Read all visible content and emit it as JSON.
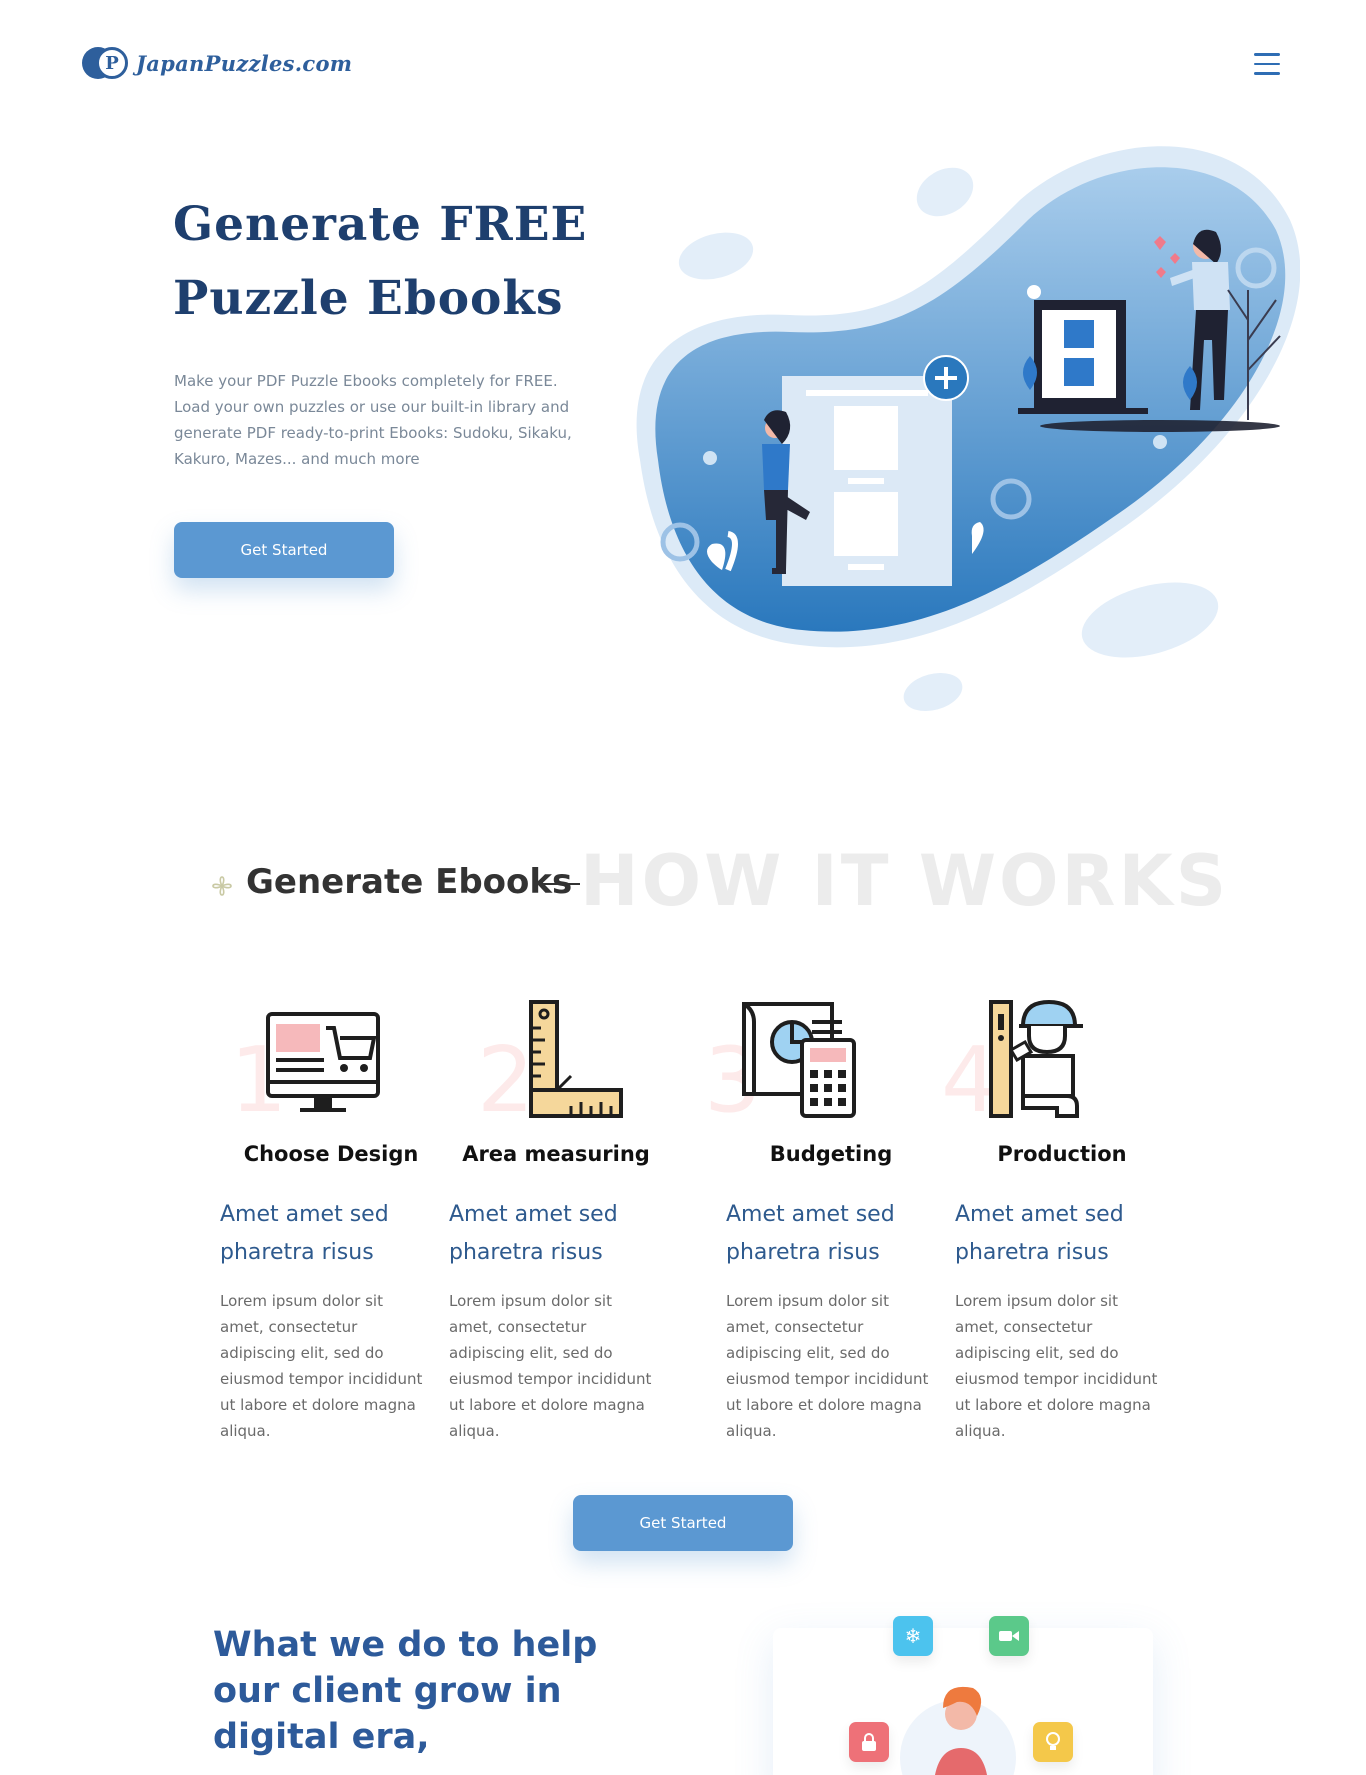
{
  "brand": {
    "logo_letter": "P",
    "name": "JapanPuzzles.com"
  },
  "hero": {
    "title": "Generate FREE Puzzle Ebooks",
    "description": "Make your PDF Puzzle Ebooks completely for FREE. Load your own puzzles or use our built-in library and generate PDF ready-to-print Ebooks: Sudoku, Sikaku, Kakuro, Mazes... and much more",
    "button": "Get Started"
  },
  "how": {
    "background_word": "HOW IT WORKS",
    "title": "Generate Ebooks",
    "steps": [
      {
        "num": "1",
        "label": "Choose Design",
        "subtitle": "Amet amet sed pharetra risus",
        "body": "Lorem ipsum dolor sit amet, consectetur adipiscing elit, sed do eiusmod tempor incididunt ut labore et dolore magna aliqua.",
        "icon": "monitor-cart-icon"
      },
      {
        "num": "2",
        "label": "Area measuring",
        "subtitle": "Amet amet sed pharetra risus",
        "body": "Lorem ipsum dolor sit amet, consectetur adipiscing elit, sed do eiusmod tempor incididunt ut labore et dolore magna aliqua.",
        "icon": "ruler-square-icon"
      },
      {
        "num": "3",
        "label": "Budgeting",
        "subtitle": "Amet amet sed pharetra risus",
        "body": "Lorem ipsum dolor sit amet, consectetur adipiscing elit, sed do eiusmod tempor incididunt ut labore et dolore magna aliqua.",
        "icon": "calculator-blueprint-icon"
      },
      {
        "num": "4",
        "label": "Production",
        "subtitle": "Amet amet sed pharetra risus",
        "body": "Lorem ipsum dolor sit amet, consectetur adipiscing elit, sed do eiusmod tempor incididunt ut labore et dolore magna aliqua.",
        "icon": "worker-icon"
      }
    ],
    "button": "Get Started"
  },
  "what": {
    "title": "What we do to help our client grow in digital era,"
  },
  "colors": {
    "primary": "#5b98d2",
    "navy": "#1e3f6e",
    "logo": "#2e5f9c"
  }
}
